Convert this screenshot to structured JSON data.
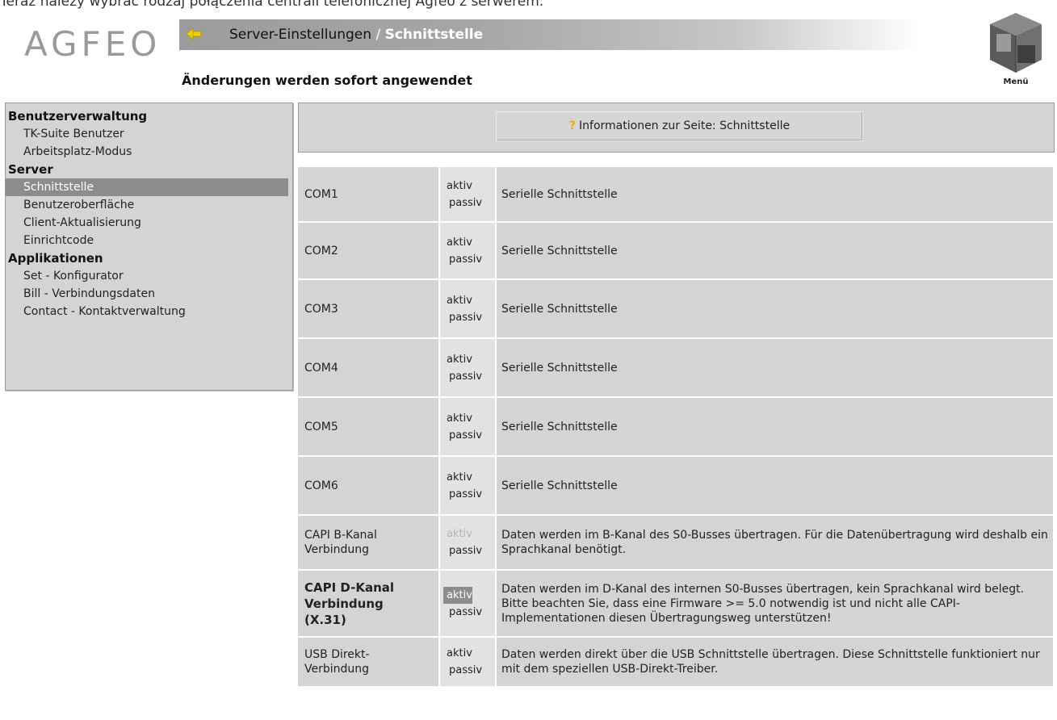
{
  "top_text": "Teraz należy wybrać rodzaj połączenia centrali telefonicznej Agfeo z serwerem.",
  "header": {
    "logo": "AGFEO",
    "breadcrumb_parent": "Server-Einstellungen",
    "breadcrumb_sep": "/",
    "breadcrumb_current": "Schnittstelle",
    "subtitle": "Änderungen werden sofort angewendet",
    "menu_label": "Menü"
  },
  "sidebar": {
    "groups": [
      {
        "label": "Benutzerverwaltung",
        "items": [
          "TK-Suite Benutzer",
          "Arbeitsplatz-Modus"
        ]
      },
      {
        "label": "Server",
        "items": [
          "Schnittstelle",
          "Benutzeroberfläche",
          "Client-Aktualisierung",
          "Einrichtcode"
        ]
      },
      {
        "label": "Applikationen",
        "items": [
          "Set - Konfigurator",
          "Bill - Verbindungsdaten",
          "Contact - Kontaktverwaltung"
        ]
      }
    ],
    "active_item": "Schnittstelle"
  },
  "info": {
    "label": "Informationen zur Seite: Schnittstelle"
  },
  "options": {
    "aktiv": "aktiv",
    "passiv": "passiv"
  },
  "rows": [
    {
      "name": "COM1",
      "desc": "Serielle Schnittstelle",
      "state": "none"
    },
    {
      "name": "COM2",
      "desc": "Serielle Schnittstelle",
      "state": "none"
    },
    {
      "name": "COM3",
      "desc": "Serielle Schnittstelle",
      "state": "none"
    },
    {
      "name": "COM4",
      "desc": "Serielle Schnittstelle",
      "state": "none"
    },
    {
      "name": "COM5",
      "desc": "Serielle Schnittstelle",
      "state": "none"
    },
    {
      "name": "COM6",
      "desc": "Serielle Schnittstelle",
      "state": "none"
    },
    {
      "name": "CAPI B-Kanal Verbindung",
      "desc": "Daten werden im B-Kanal des S0-Busses übertragen. Für die Datenübertragung wird deshalb ein Sprachkanal benötigt.",
      "state": "aktiv-disabled"
    },
    {
      "name": "CAPI D-Kanal Verbindung (X.31)",
      "desc": "Daten werden im D-Kanal des internen S0-Busses übertragen, kein Sprachkanal wird belegt. Bitte beachten Sie, dass eine Firmware >= 5.0 notwendig ist und nicht alle CAPI-Implementationen diesen Übertragungsweg unterstützen!",
      "state": "aktiv-selected"
    },
    {
      "name": "USB Direkt-Verbindung",
      "desc": "Daten werden direkt über die USB Schnittstelle übertragen. Diese Schnittstelle funktioniert nur mit dem speziellen USB-Direkt-Treiber.",
      "state": "none"
    }
  ],
  "colors": {
    "active_bg": "#8c8c8c",
    "panel_bg": "#d4d4d4",
    "info_icon": "#e3b400",
    "back_arrow": "#f0d000"
  }
}
